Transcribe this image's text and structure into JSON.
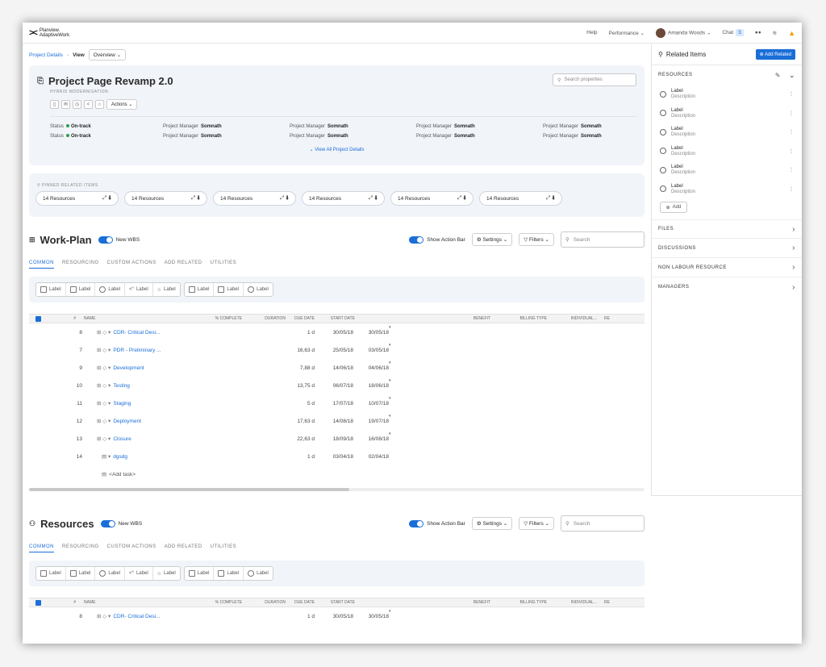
{
  "topbar": {
    "brand_line1": "Planview.",
    "brand_line2": "AdaptiveWork",
    "help": "Help",
    "performance": "Performance",
    "user": "Amanda Woods",
    "chat": "Chat",
    "chat_count": "3"
  },
  "breadcrumb": {
    "project_details": "Project Details",
    "view": "View",
    "view_value": "Overview"
  },
  "project": {
    "title": "Project Page Revamp 2.0",
    "subtitle": "HYBRID MODERNISATION",
    "actions": "Actions",
    "search_placeholder": "Search properties",
    "status_label": "Status",
    "status_value": "On-track",
    "pm_label": "Project Manager",
    "pm_value": "Somnath",
    "view_all": "View All Project Details"
  },
  "pinned": {
    "label": "PINNED RELATED ITEMS",
    "items": [
      "14 Resources",
      "14 Resources",
      "14 Resources",
      "14 Resources",
      "14 Resources",
      "14 Resources"
    ]
  },
  "workplan": {
    "title": "Work-Plan",
    "new_wbs": "New WBS",
    "show_action_bar": "Show Action Bar",
    "settings": "Settings",
    "filters": "Filters",
    "search": "Search",
    "tabs": [
      "COMMON",
      "RESOURCING",
      "CUSTOM ACTIONS",
      "ADD RELATED",
      "UTILITIES"
    ],
    "action_label": "Label",
    "columns": [
      "#",
      "NAME",
      "% COMPLETE",
      "DURATION",
      "DUE DATE",
      "START DATE",
      "BENEFIT",
      "BILLING TYPE",
      "INDIVIDUAL...",
      "RE"
    ],
    "rows": [
      {
        "num": "8",
        "name": "CDR- Critical Desi...",
        "duration": "1 d",
        "due": "30/05/18",
        "start": "30/05/18"
      },
      {
        "num": "7",
        "name": "PDR - Preliminary ...",
        "duration": "16,63 d",
        "due": "25/05/18",
        "start": "03/05/18"
      },
      {
        "num": "9",
        "name": "Development",
        "duration": "7,88 d",
        "due": "14/06/18",
        "start": "04/06/18"
      },
      {
        "num": "10",
        "name": "Testing",
        "duration": "13,75 d",
        "due": "06/07/18",
        "start": "18/06/18"
      },
      {
        "num": "11",
        "name": "Staging",
        "duration": "5 d",
        "due": "17/07/18",
        "start": "10/07/18"
      },
      {
        "num": "12",
        "name": "Deployment",
        "duration": "17,63 d",
        "due": "14/08/18",
        "start": "19/07/18"
      },
      {
        "num": "13",
        "name": "Closure",
        "duration": "22,63 d",
        "due": "18/09/18",
        "start": "16/08/18"
      },
      {
        "num": "14",
        "name": "dgsdg",
        "duration": "1 d",
        "due": "03/04/18",
        "start": "02/04/18"
      }
    ],
    "add_task": "<Add task>"
  },
  "resources_section": {
    "title": "Resources",
    "new_wbs": "New WBS",
    "show_action_bar": "Show Action Bar",
    "settings": "Settings",
    "filters": "Filters",
    "search": "Search",
    "first_row_num": "8",
    "first_row_name": "CDR- Critical Desi...",
    "first_row_duration": "1 d",
    "first_row_due": "30/05/18",
    "first_row_start": "30/05/18"
  },
  "related": {
    "title": "Related Items",
    "add_related": "Add Related",
    "resources_label": "RESOURCES",
    "items": [
      {
        "label": "Label",
        "desc": "Description"
      },
      {
        "label": "Label",
        "desc": "Description"
      },
      {
        "label": "Label",
        "desc": "Description"
      },
      {
        "label": "Label",
        "desc": "Description"
      },
      {
        "label": "Label",
        "desc": "Description"
      },
      {
        "label": "Label",
        "desc": "Description"
      }
    ],
    "add": "Add",
    "files": "FILES",
    "discussions": "DISCUSSIONS",
    "non_labour": "NON LABOUR RESOURCE",
    "managers": "MANAGERS"
  }
}
